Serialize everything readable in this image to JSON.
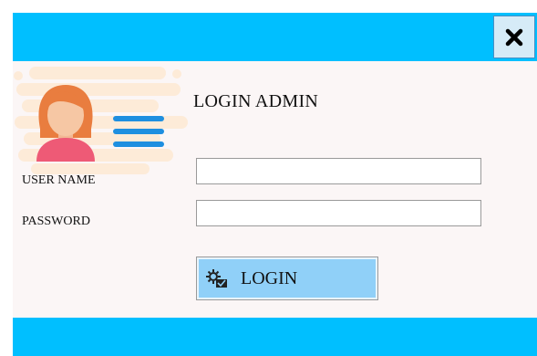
{
  "window": {
    "accent_color": "#00bfff",
    "close_icon": "close-icon"
  },
  "login": {
    "heading": "LOGIN ADMIN",
    "avatar_icon": "user-avatar-icon",
    "username_label": "USER NAME",
    "username_value": "",
    "password_label": "PASSWORD",
    "password_value": "",
    "button_label": "LOGIN",
    "button_icon": "login-gear-icon"
  }
}
